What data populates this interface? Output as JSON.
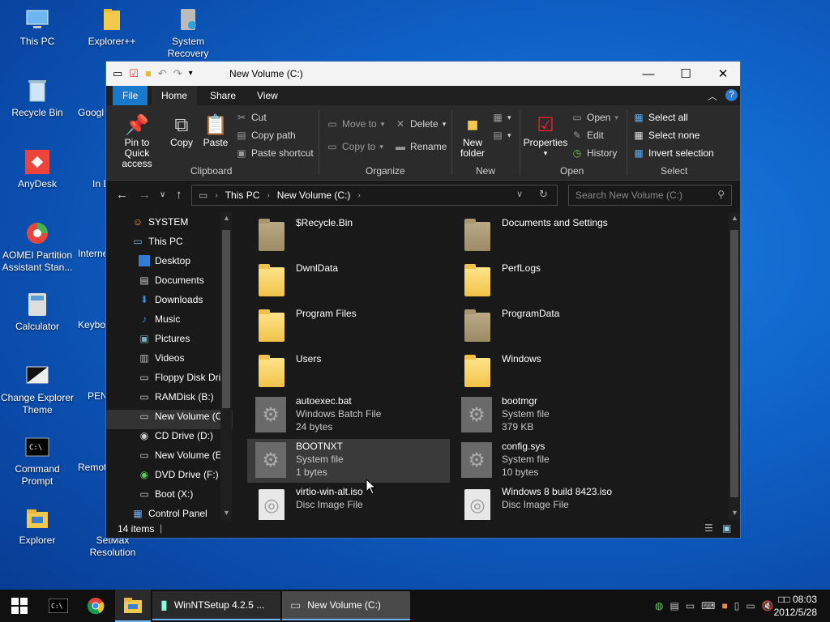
{
  "desktop": {
    "icons": [
      {
        "label": "This PC",
        "icon": "computer-icon"
      },
      {
        "label": "Explorer++",
        "icon": "folder-icon"
      },
      {
        "label": "System Recovery",
        "icon": "recovery-icon"
      },
      {
        "label": "Recycle Bin",
        "icon": "recycle-bin-icon"
      },
      {
        "label": "Googl",
        "icon": "chrome-icon"
      },
      {
        "label": "AnyDesk",
        "icon": "anydesk-icon"
      },
      {
        "label": "In Do",
        "icon": "app-icon"
      },
      {
        "label": "AOMEI Partition Assistant Stan...",
        "icon": "aomei-icon"
      },
      {
        "label": "Interne",
        "icon": "internet-icon"
      },
      {
        "label": "Calculator",
        "icon": "calculator-icon"
      },
      {
        "label": "Keybo",
        "icon": "keyboard-icon"
      },
      {
        "label": "Change Explorer Theme",
        "icon": "theme-icon"
      },
      {
        "label": "PEN",
        "icon": "app-icon"
      },
      {
        "label": "Command Prompt",
        "icon": "cmd-icon"
      },
      {
        "label": "Remot",
        "icon": "remote-icon"
      },
      {
        "label": "Explorer",
        "icon": "explorer-folder-icon"
      },
      {
        "label": "SetMax Resolution",
        "icon": "resolution-icon"
      }
    ]
  },
  "window": {
    "title": "New Volume (C:)",
    "tabs": {
      "file": "File",
      "home": "Home",
      "share": "Share",
      "view": "View"
    },
    "ribbon": {
      "clipboard": {
        "label": "Clipboard",
        "pin": "Pin to Quick access",
        "copy": "Copy",
        "paste": "Paste",
        "cut": "Cut",
        "copy_path": "Copy path",
        "paste_shortcut": "Paste shortcut"
      },
      "organize": {
        "label": "Organize",
        "move_to": "Move to",
        "copy_to": "Copy to",
        "delete": "Delete",
        "rename": "Rename"
      },
      "new": {
        "label": "New",
        "new_folder": "New folder"
      },
      "open": {
        "label": "Open",
        "properties": "Properties",
        "open": "Open",
        "edit": "Edit",
        "history": "History"
      },
      "select": {
        "label": "Select",
        "select_all": "Select all",
        "select_none": "Select none",
        "invert": "Invert selection"
      }
    },
    "address": {
      "crumbs": [
        "This PC",
        "New Volume (C:)"
      ],
      "search_placeholder": "Search New Volume (C:)"
    },
    "nav": {
      "items": [
        {
          "label": "SYSTEM",
          "icon": "user-icon"
        },
        {
          "label": "This PC",
          "icon": "computer-icon"
        },
        {
          "label": "Desktop",
          "icon": "desktop-icon"
        },
        {
          "label": "Documents",
          "icon": "documents-icon"
        },
        {
          "label": "Downloads",
          "icon": "downloads-icon"
        },
        {
          "label": "Music",
          "icon": "music-icon"
        },
        {
          "label": "Pictures",
          "icon": "pictures-icon"
        },
        {
          "label": "Videos",
          "icon": "videos-icon"
        },
        {
          "label": "Floppy Disk Dri",
          "icon": "drive-icon"
        },
        {
          "label": "RAMDisk (B:)",
          "icon": "drive-icon"
        },
        {
          "label": "New Volume (C",
          "icon": "drive-icon"
        },
        {
          "label": "CD Drive (D:)",
          "icon": "cd-icon"
        },
        {
          "label": "New Volume (E",
          "icon": "drive-icon"
        },
        {
          "label": "DVD Drive (F:) I",
          "icon": "dvd-icon"
        },
        {
          "label": "Boot (X:)",
          "icon": "drive-icon"
        },
        {
          "label": "Control Panel",
          "icon": "control-panel-icon"
        }
      ]
    },
    "files": [
      {
        "name": "$Recycle.Bin",
        "kind": "folder-dark",
        "type": "",
        "size": ""
      },
      {
        "name": "Documents and Settings",
        "kind": "folder-dark",
        "type": "",
        "size": ""
      },
      {
        "name": "DwnlData",
        "kind": "folder",
        "type": "",
        "size": ""
      },
      {
        "name": "PerfLogs",
        "kind": "folder",
        "type": "",
        "size": ""
      },
      {
        "name": "Program Files",
        "kind": "folder",
        "type": "",
        "size": ""
      },
      {
        "name": "ProgramData",
        "kind": "folder-dark",
        "type": "",
        "size": ""
      },
      {
        "name": "Users",
        "kind": "folder",
        "type": "",
        "size": ""
      },
      {
        "name": "Windows",
        "kind": "folder",
        "type": "",
        "size": ""
      },
      {
        "name": "autoexec.bat",
        "kind": "gear",
        "type": "Windows Batch File",
        "size": "24 bytes"
      },
      {
        "name": "bootmgr",
        "kind": "gear",
        "type": "System file",
        "size": "379 KB"
      },
      {
        "name": "BOOTNXT",
        "kind": "gear",
        "type": "System file",
        "size": "1 bytes"
      },
      {
        "name": "config.sys",
        "kind": "gear",
        "type": "System file",
        "size": "10 bytes"
      },
      {
        "name": "virtio-win-alt.iso",
        "kind": "disc",
        "type": "Disc Image File",
        "size": ""
      },
      {
        "name": "Windows 8 build 8423.iso",
        "kind": "disc",
        "type": "Disc Image File",
        "size": ""
      }
    ],
    "status": {
      "count": "14 items"
    }
  },
  "taskbar": {
    "tasks": [
      {
        "label": "WinNTSetup 4.2.5 ...",
        "icon": "winntsetup-icon"
      },
      {
        "label": "New Volume (C:)",
        "icon": "drive-icon"
      }
    ],
    "clock": {
      "time": "□□ 08:03",
      "date": "2012/5/28"
    }
  },
  "colors": {
    "accent": "#1979ca",
    "window_bg": "#191919",
    "ribbon_bg": "#2b2b2b"
  }
}
